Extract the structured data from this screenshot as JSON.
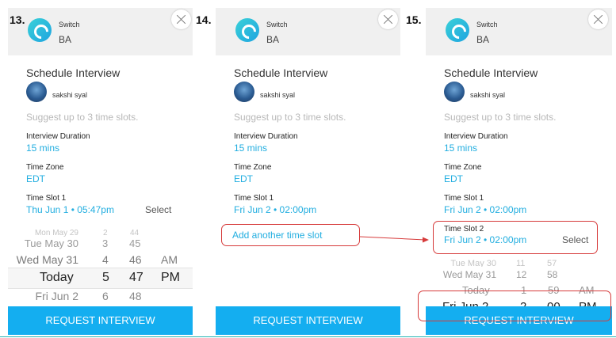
{
  "steps": [
    "13.",
    "14.",
    "15."
  ],
  "company": {
    "name": "Switch",
    "subtitle": "BA"
  },
  "modal": {
    "title": "Schedule Interview",
    "candidate": "sakshi syal",
    "hint": "Suggest up to 3 time slots.",
    "duration_label": "Interview Duration",
    "duration_value": "15 mins",
    "timezone_label": "Time Zone",
    "timezone_value": "EDT",
    "cta": "REQUEST INTERVIEW"
  },
  "panel1": {
    "slot_label": "Time Slot 1",
    "slot_value": "Thu Jun 1 • 05:47pm",
    "select": "Select",
    "picker": [
      {
        "date": "Mon May 29",
        "hour": "2",
        "minute": "44",
        "ampm": ""
      },
      {
        "date": "Tue May 30",
        "hour": "3",
        "minute": "45",
        "ampm": ""
      },
      {
        "date": "Wed May 31",
        "hour": "4",
        "minute": "46",
        "ampm": "AM"
      },
      {
        "date": "Today",
        "hour": "5",
        "minute": "47",
        "ampm": "PM"
      },
      {
        "date": "Fri Jun 2",
        "hour": "6",
        "minute": "48",
        "ampm": ""
      }
    ]
  },
  "panel2": {
    "slot_label": "Time Slot 1",
    "slot_value": "Fri Jun 2 • 02:00pm",
    "add_link": "Add another time slot"
  },
  "panel3": {
    "slot1_label": "Time Slot 1",
    "slot1_value": "Fri Jun 2 • 02:00pm",
    "slot2_label": "Time Slot 2",
    "slot2_value": "Fri Jun 2 • 02:00pm",
    "select": "Select",
    "picker": [
      {
        "date": "Tue May 30",
        "hour": "11",
        "minute": "57",
        "ampm": ""
      },
      {
        "date": "Wed May 31",
        "hour": "12",
        "minute": "58",
        "ampm": ""
      },
      {
        "date": "Today",
        "hour": "1",
        "minute": "59",
        "ampm": "AM"
      },
      {
        "date": "Fri Jun 2",
        "hour": "2",
        "minute": "00",
        "ampm": "PM"
      }
    ]
  },
  "colors": {
    "accent": "#22aee0",
    "cta": "#14aef0",
    "annotation": "#d63a3a"
  }
}
